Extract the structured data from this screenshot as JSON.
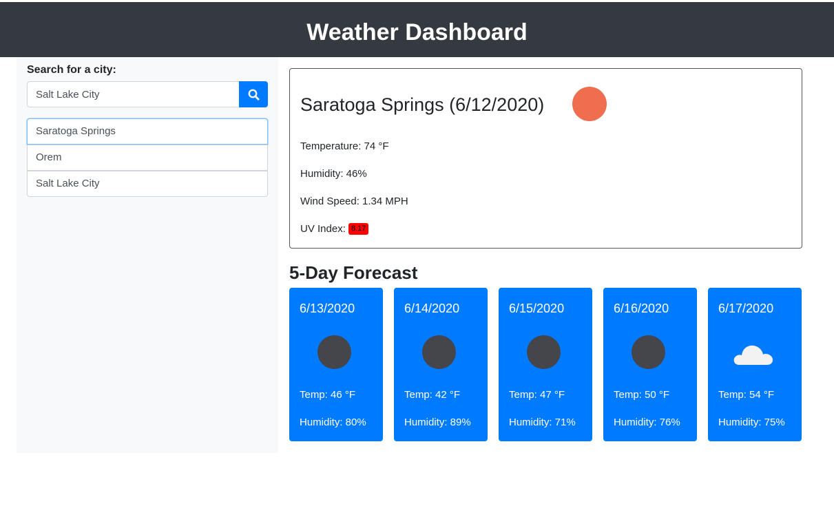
{
  "header": {
    "title": "Weather Dashboard"
  },
  "search": {
    "label": "Search for a city:",
    "value": "Salt Lake City",
    "button_icon": "search-icon"
  },
  "history": [
    {
      "label": "Saratoga Springs"
    },
    {
      "label": "Orem"
    },
    {
      "label": "Salt Lake City"
    }
  ],
  "current": {
    "title": "Saratoga Springs (6/12/2020)",
    "icon": "sun-icon",
    "temperature": "Temperature: 74 °F",
    "humidity": "Humidity: 46%",
    "wind": "Wind Speed: 1.34 MPH",
    "uv_label": "UV Index:",
    "uv_value": "8.17",
    "uv_color": "#ff0000"
  },
  "forecast": {
    "title": "5-Day Forecast",
    "days": [
      {
        "date": "6/13/2020",
        "icon": "clear-night-icon",
        "temp": "Temp: 46 °F",
        "humidity": "Humidity: 80%"
      },
      {
        "date": "6/14/2020",
        "icon": "clear-night-icon",
        "temp": "Temp: 42 °F",
        "humidity": "Humidity: 89%"
      },
      {
        "date": "6/15/2020",
        "icon": "clear-night-icon",
        "temp": "Temp: 47 °F",
        "humidity": "Humidity: 71%"
      },
      {
        "date": "6/16/2020",
        "icon": "clear-night-icon",
        "temp": "Temp: 50 °F",
        "humidity": "Humidity: 76%"
      },
      {
        "date": "6/17/2020",
        "icon": "cloud-icon",
        "temp": "Temp: 54 °F",
        "humidity": "Humidity: 75%"
      }
    ]
  },
  "colors": {
    "header_bg": "#343a40",
    "accent": "#007bff",
    "sun": "#ee6e4f"
  }
}
